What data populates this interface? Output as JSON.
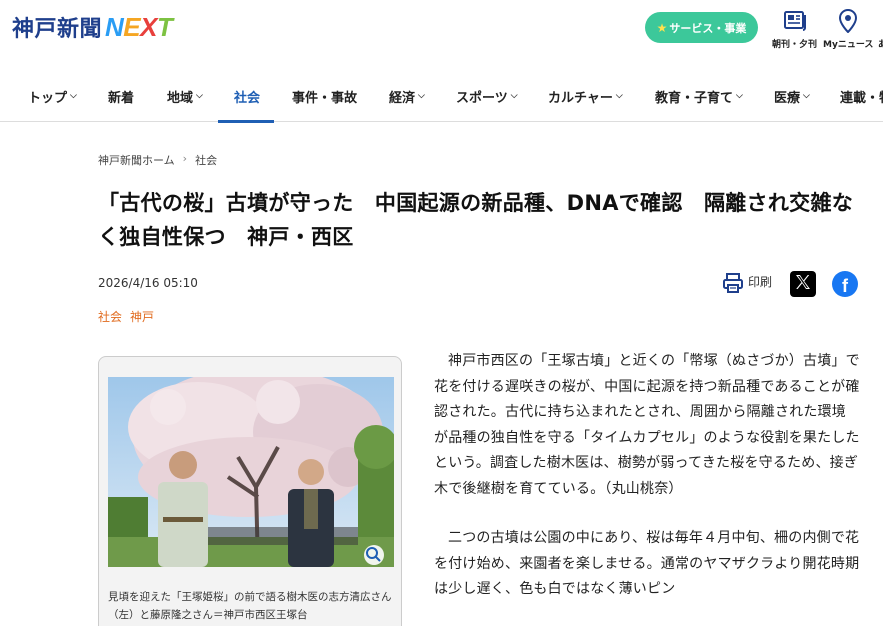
{
  "header": {
    "logo_jp": "神戸新聞",
    "logo_en": [
      "N",
      "E",
      "X",
      "T"
    ],
    "service_button": "サービス・事業",
    "icons": [
      {
        "name": "newspaper-icon",
        "label": "朝刊・夕刊"
      },
      {
        "name": "location-pin-icon",
        "label": "Myニュース"
      }
    ]
  },
  "nav": {
    "items": [
      {
        "label": "トップ",
        "chevron": true,
        "active": false
      },
      {
        "label": "新着",
        "chevron": false,
        "active": false
      },
      {
        "label": "地域",
        "chevron": true,
        "active": false
      },
      {
        "label": "社会",
        "chevron": false,
        "active": true
      },
      {
        "label": "事件・事故",
        "chevron": false,
        "active": false
      },
      {
        "label": "経済",
        "chevron": true,
        "active": false
      },
      {
        "label": "スポーツ",
        "chevron": true,
        "active": false
      },
      {
        "label": "カルチャー",
        "chevron": true,
        "active": false
      },
      {
        "label": "教育・子育て",
        "chevron": true,
        "active": false
      },
      {
        "label": "医療",
        "chevron": true,
        "active": false
      },
      {
        "label": "連載・特",
        "chevron": false,
        "active": false
      }
    ]
  },
  "breadcrumb": {
    "home": "神戸新聞ホーム",
    "separator": "›",
    "current": "社会"
  },
  "article": {
    "title": "「古代の桜」古墳が守った　中国起源の新品種、DNAで確認　隔離され交雑なく独自性保つ　神戸・西区",
    "date": "2026/4/16 05:10",
    "tags": [
      "社会",
      "神戸"
    ],
    "print_label": "印刷",
    "photo_caption": "見頃を迎えた「王塚姫桜」の前で語る樹木医の志方清広さん（左）と藤原隆之さん＝神戸市西区王塚台",
    "paragraphs": [
      "神戸市西区の「王塚古墳」と近くの「幣塚（ぬさづか）古墳」で花を付ける遅咲きの桜が、中国に起源を持つ新品種であることが確認された。古代に持ち込まれたとされ、周囲から隔離された環境が品種の独自性を守る「タイムカプセル」のような役割を果たしたという。調査した樹木医は、樹勢が弱ってきた桜を守るため、接ぎ木で後継樹を育てている。（丸山桃奈）",
      "二つの古墳は公園の中にあり、桜は毎年４月中旬、柵の内側で花を付け始め、来園者を楽しませる。通常のヤマザクラより開花時期は少し遅く、色も白ではなく薄いピン"
    ]
  },
  "colors": {
    "brand_blue": "#1f3f8c",
    "service_green": "#3cc89a",
    "nav_active": "#1f5fb4",
    "tag_orange": "#e06b1f",
    "facebook_blue": "#1877f2"
  }
}
